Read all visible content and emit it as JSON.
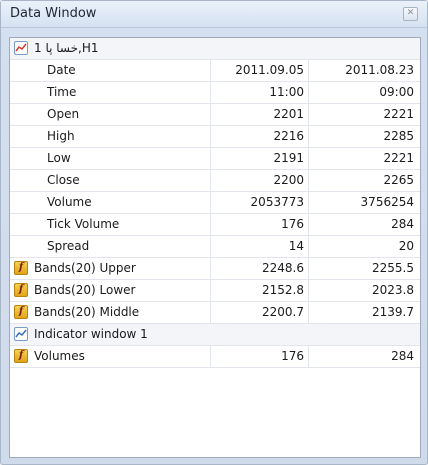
{
  "window": {
    "title": "Data Window"
  },
  "symbol": {
    "label": "خسا پا 1,H1"
  },
  "rows": [
    {
      "label": "Date",
      "v1": "2011.09.05",
      "v2": "2011.08.23"
    },
    {
      "label": "Time",
      "v1": "11:00",
      "v2": "09:00"
    },
    {
      "label": "Open",
      "v1": "2201",
      "v2": "2221"
    },
    {
      "label": "High",
      "v1": "2216",
      "v2": "2285"
    },
    {
      "label": "Low",
      "v1": "2191",
      "v2": "2221"
    },
    {
      "label": "Close",
      "v1": "2200",
      "v2": "2265"
    },
    {
      "label": "Volume",
      "v1": "2053773",
      "v2": "3756254"
    },
    {
      "label": "Tick Volume",
      "v1": "176",
      "v2": "284"
    },
    {
      "label": "Spread",
      "v1": "14",
      "v2": "20"
    }
  ],
  "indicators": [
    {
      "label": "Bands(20) Upper",
      "v1": "2248.6",
      "v2": "2255.5"
    },
    {
      "label": "Bands(20) Lower",
      "v1": "2152.8",
      "v2": "2023.8"
    },
    {
      "label": "Bands(20) Middle",
      "v1": "2200.7",
      "v2": "2139.7"
    }
  ],
  "indicator_window": {
    "label": "Indicator window 1",
    "rows": [
      {
        "label": "Volumes",
        "v1": "176",
        "v2": "284"
      }
    ]
  },
  "icons": {
    "chart": "chart-icon",
    "function": "function-icon",
    "close": "close-icon"
  }
}
